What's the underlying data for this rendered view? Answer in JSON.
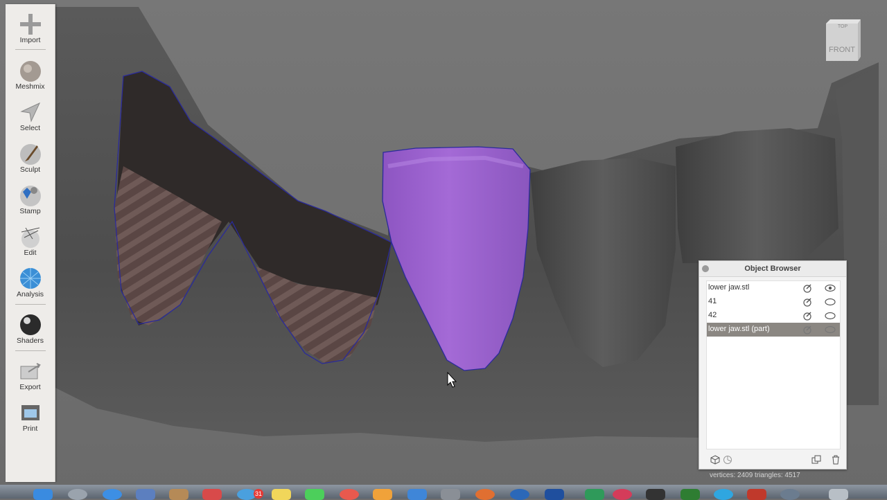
{
  "toolbar": {
    "import": "Import",
    "meshmix": "Meshmix",
    "select": "Select",
    "sculpt": "Sculpt",
    "stamp": "Stamp",
    "edit": "Edit",
    "analysis": "Analysis",
    "shaders": "Shaders",
    "export": "Export",
    "print": "Print"
  },
  "viewcube": {
    "top": "TOP",
    "front": "FRONT"
  },
  "object_browser": {
    "title": "Object Browser",
    "items": [
      {
        "name": "lower jaw.stl",
        "selected": false
      },
      {
        "name": "41",
        "selected": false
      },
      {
        "name": "42",
        "selected": false
      },
      {
        "name": "lower jaw.stl (part)",
        "selected": true
      }
    ]
  },
  "status": "vertices: 2409 triangles: 4517",
  "dock": {
    "calendar_badge": "31"
  },
  "colors": {
    "selection": "#a468d8",
    "mesh": "#5f5f5f",
    "outline": "#2a2a9a"
  }
}
